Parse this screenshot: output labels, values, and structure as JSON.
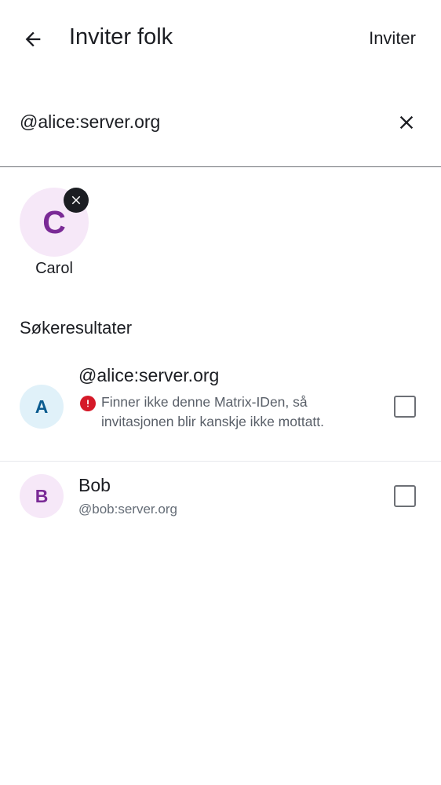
{
  "header": {
    "back_icon": "arrow-left-icon",
    "title": "Inviter folk",
    "invite_label": "Inviter"
  },
  "search": {
    "value": "@alice:server.org",
    "clear_icon": "close-icon"
  },
  "selected": [
    {
      "initial": "C",
      "name": "Carol",
      "avatar_color": "#f6e8f8",
      "letter_color": "#7a2a96",
      "remove_icon": "close-icon"
    }
  ],
  "results": {
    "header": "Søkeresultater",
    "items": [
      {
        "initial": "A",
        "title": "@alice:server.org",
        "warning": "Finner ikke denne Matrix-IDen, så invitasjonen blir kanskje ikke mottatt.",
        "warning_icon": "error-icon",
        "checked": false,
        "avatar_color": "#e0f1f9"
      },
      {
        "initial": "B",
        "title": "Bob",
        "subtitle": "@bob:server.org",
        "checked": false,
        "avatar_color": "#f6e8f8"
      }
    ]
  },
  "colors": {
    "warning": "#d51928",
    "text_primary": "#1b1d22",
    "text_secondary": "#656d77"
  }
}
